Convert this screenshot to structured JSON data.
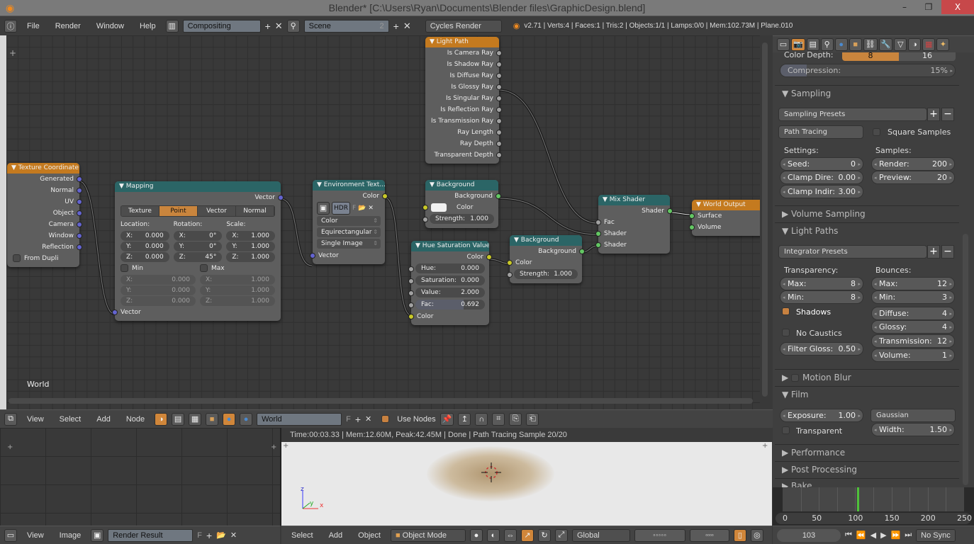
{
  "title_bar": {
    "title": "Blender* [C:\\Users\\Ryan\\Documents\\Blender files\\GraphicDesign.blend]",
    "minimize": "–",
    "maximize": "❐",
    "close": "X"
  },
  "info_header": {
    "menus": [
      "File",
      "Render",
      "Window",
      "Help"
    ],
    "screen": "Compositing",
    "scene": "Scene",
    "scene_users": "2",
    "engine": "Cycles Render",
    "stats": "v2.71 | Verts:4 | Faces:1 | Tris:2 | Objects:1/1 | Lamps:0/0 | Mem:102.73M | Plane.010"
  },
  "node_editor": {
    "label": "World",
    "nodes": [
      {
        "id": "texcoord",
        "title": "Texture Coordinate",
        "color": "orange",
        "rows": [
          {
            "k": "out",
            "label": "Generated",
            "s": "vec"
          },
          {
            "k": "out",
            "label": "Normal",
            "s": "vec"
          },
          {
            "k": "out",
            "label": "UV",
            "s": "vec"
          },
          {
            "k": "out",
            "label": "Object",
            "s": "vec"
          },
          {
            "k": "out",
            "label": "Camera",
            "s": "vec"
          },
          {
            "k": "out",
            "label": "Window",
            "s": "vec"
          },
          {
            "k": "out",
            "label": "Reflection",
            "s": "vec"
          },
          {
            "k": "check",
            "label": "From Dupli",
            "checked": false
          }
        ]
      },
      {
        "id": "mapping",
        "title": "Mapping",
        "color": "teal",
        "rows": [
          {
            "k": "out",
            "label": "Vector",
            "s": "vec"
          },
          {
            "k": "tabs",
            "items": [
              "Texture",
              "Point",
              "Vector",
              "Normal"
            ],
            "active": 1
          },
          {
            "k": "xyz",
            "groups": [
              {
                "label": "Location:",
                "values": [
                  {
                    "a": "X:",
                    "v": "0.000"
                  },
                  {
                    "a": "Y:",
                    "v": "0.000"
                  },
                  {
                    "a": "Z:",
                    "v": "0.000"
                  }
                ]
              },
              {
                "label": "Rotation:",
                "values": [
                  {
                    "a": "X:",
                    "v": "0°"
                  },
                  {
                    "a": "Y:",
                    "v": "0°"
                  },
                  {
                    "a": "Z:",
                    "v": "45°"
                  }
                ]
              },
              {
                "label": "Scale:",
                "values": [
                  {
                    "a": "X:",
                    "v": "1.000"
                  },
                  {
                    "a": "Y:",
                    "v": "1.000"
                  },
                  {
                    "a": "Z:",
                    "v": "1.000"
                  }
                ]
              }
            ]
          },
          {
            "k": "minmax",
            "groups": [
              {
                "label": "Min",
                "checked": false,
                "values": [
                  {
                    "a": "X:",
                    "v": "0.000"
                  },
                  {
                    "a": "Y:",
                    "v": "0.000"
                  },
                  {
                    "a": "Z:",
                    "v": "0.000"
                  }
                ]
              },
              {
                "label": "Max",
                "checked": false,
                "values": [
                  {
                    "a": "X:",
                    "v": "1.000"
                  },
                  {
                    "a": "Y:",
                    "v": "1.000"
                  },
                  {
                    "a": "Z:",
                    "v": "1.000"
                  }
                ]
              }
            ]
          },
          {
            "k": "in",
            "label": "Vector",
            "s": "vec"
          }
        ]
      },
      {
        "id": "env",
        "title": "Environment Text...",
        "color": "teal",
        "rows": [
          {
            "k": "out",
            "label": "Color",
            "s": "col"
          },
          {
            "k": "image",
            "hdr": "HDR",
            "f": "F"
          },
          {
            "k": "select",
            "label": "Color"
          },
          {
            "k": "select",
            "label": "Equirectangular"
          },
          {
            "k": "select",
            "label": "Single Image"
          },
          {
            "k": "in",
            "label": "Vector",
            "s": "vec"
          }
        ]
      },
      {
        "id": "lightpath",
        "title": "Light Path",
        "color": "orange",
        "rows": [
          {
            "k": "out",
            "label": "Is Camera Ray",
            "s": "gray"
          },
          {
            "k": "out",
            "label": "Is Shadow Ray",
            "s": "gray"
          },
          {
            "k": "out",
            "label": "Is Diffuse Ray",
            "s": "gray"
          },
          {
            "k": "out",
            "label": "Is Glossy Ray",
            "s": "gray"
          },
          {
            "k": "out",
            "label": "Is Singular Ray",
            "s": "gray"
          },
          {
            "k": "out",
            "label": "Is Reflection Ray",
            "s": "gray"
          },
          {
            "k": "out",
            "label": "Is Transmission Ray",
            "s": "gray"
          },
          {
            "k": "out",
            "label": "Ray Length",
            "s": "gray"
          },
          {
            "k": "out",
            "label": "Ray Depth",
            "s": "gray"
          },
          {
            "k": "out",
            "label": "Transparent Depth",
            "s": "gray"
          }
        ]
      },
      {
        "id": "bg1",
        "title": "Background",
        "color": "teal",
        "rows": [
          {
            "k": "out",
            "label": "Background",
            "s": "sh"
          },
          {
            "k": "color",
            "label": "Color",
            "swatch": "#f0f0f0"
          },
          {
            "k": "field",
            "label": "Strength:",
            "v": "1.000",
            "s": "gray"
          }
        ]
      },
      {
        "id": "hsv",
        "title": "Hue Saturation Value",
        "color": "teal",
        "rows": [
          {
            "k": "out",
            "label": "Color",
            "s": "col"
          },
          {
            "k": "field",
            "label": "Hue:",
            "v": "0.000",
            "s": "gray"
          },
          {
            "k": "field",
            "label": "Saturation:",
            "v": "0.000",
            "s": "gray"
          },
          {
            "k": "field",
            "label": "Value:",
            "v": "2.000",
            "s": "gray"
          },
          {
            "k": "field",
            "label": "Fac:",
            "v": "0.692",
            "s": "gray",
            "fill": 0.692
          },
          {
            "k": "in",
            "label": "Color",
            "s": "col"
          }
        ]
      },
      {
        "id": "bg2",
        "title": "Background",
        "color": "teal",
        "rows": [
          {
            "k": "out",
            "label": "Background",
            "s": "sh"
          },
          {
            "k": "in",
            "label": "Color",
            "s": "col"
          },
          {
            "k": "field",
            "label": "Strength:",
            "v": "1.000",
            "s": "gray"
          }
        ]
      },
      {
        "id": "mix",
        "title": "Mix Shader",
        "color": "teal",
        "rows": [
          {
            "k": "out",
            "label": "Shader",
            "s": "sh"
          },
          {
            "k": "in",
            "label": "Fac",
            "s": "gray"
          },
          {
            "k": "in",
            "label": "Shader",
            "s": "sh"
          },
          {
            "k": "in",
            "label": "Shader",
            "s": "sh"
          }
        ]
      },
      {
        "id": "worldout",
        "title": "World Output",
        "color": "orange",
        "rows": [
          {
            "k": "in",
            "label": "Surface",
            "s": "sh"
          },
          {
            "k": "in",
            "label": "Volume",
            "s": "sh"
          }
        ]
      }
    ]
  },
  "node_header": {
    "menus": [
      "View",
      "Select",
      "Add",
      "Node"
    ],
    "world": "World",
    "world_f": "F",
    "use_nodes": "Use Nodes",
    "use_nodes_checked": true
  },
  "image_header": {
    "menus": [
      "View",
      "Image"
    ],
    "image": "Render Result",
    "f": "F"
  },
  "render_view": {
    "info": "Time:00:03.33 | Mem:12.60M, Peak:42.45M | Done | Path Tracing Sample 20/20",
    "axis_x": "x",
    "axis_y": "y",
    "axis_z": "z"
  },
  "view3d_header": {
    "menus": [
      "Select",
      "Add",
      "Object"
    ],
    "mode": "Object Mode",
    "orientation": "Global"
  },
  "properties": {
    "color_depth": {
      "label": "Color Depth:",
      "options": [
        "8",
        "16"
      ],
      "selected": "8"
    },
    "compression": {
      "label": "Compression:",
      "value": "15%",
      "fraction": 0.15
    },
    "sampling": {
      "title": "Sampling",
      "presets": "Sampling Presets",
      "integrator": "Path Tracing",
      "square_samples": "Square Samples",
      "square_checked": false,
      "settings_label": "Settings:",
      "samples_label": "Samples:",
      "seed": {
        "label": "Seed:",
        "value": "0"
      },
      "clamp_direct": {
        "label": "Clamp Dire:",
        "value": "0.00"
      },
      "clamp_indirect": {
        "label": "Clamp Indir:",
        "value": "3.00"
      },
      "render": {
        "label": "Render:",
        "value": "200"
      },
      "preview": {
        "label": "Preview:",
        "value": "20"
      }
    },
    "volume_sampling": {
      "title": "Volume Sampling"
    },
    "light_paths": {
      "title": "Light Paths",
      "presets": "Integrator Presets",
      "transparency_label": "Transparency:",
      "bounces_label": "Bounces:",
      "t_max": {
        "label": "Max:",
        "value": "8"
      },
      "t_min": {
        "label": "Min:",
        "value": "8"
      },
      "shadows": "Shadows",
      "shadows_checked": true,
      "no_caustics": "No Caustics",
      "no_caustics_checked": false,
      "filter_gloss": {
        "label": "Filter Gloss:",
        "value": "0.50"
      },
      "b_max": {
        "label": "Max:",
        "value": "12"
      },
      "b_min": {
        "label": "Min:",
        "value": "3"
      },
      "diffuse": {
        "label": "Diffuse:",
        "value": "4"
      },
      "glossy": {
        "label": "Glossy:",
        "value": "4"
      },
      "transmission": {
        "label": "Transmission:",
        "value": "12"
      },
      "volume": {
        "label": "Volume:",
        "value": "1"
      }
    },
    "motion_blur": {
      "title": "Motion Blur",
      "checked": false
    },
    "film": {
      "title": "Film",
      "exposure": {
        "label": "Exposure:",
        "value": "1.00"
      },
      "transparent": "Transparent",
      "transparent_checked": false,
      "filter": "Gaussian",
      "width": {
        "label": "Width:",
        "value": "1.50"
      }
    },
    "performance": {
      "title": "Performance"
    },
    "post_processing": {
      "title": "Post Processing"
    },
    "bake": {
      "title": "Bake"
    }
  },
  "timeline": {
    "ticks": [
      "0",
      "50",
      "100",
      "150",
      "200",
      "250"
    ],
    "current_frame": "103",
    "sync": "No Sync"
  },
  "colors": {
    "accent": "#c9853d",
    "frame_marker": "#4fc13a",
    "node_teal": "#2b6566",
    "node_orange": "#c47a1f"
  }
}
